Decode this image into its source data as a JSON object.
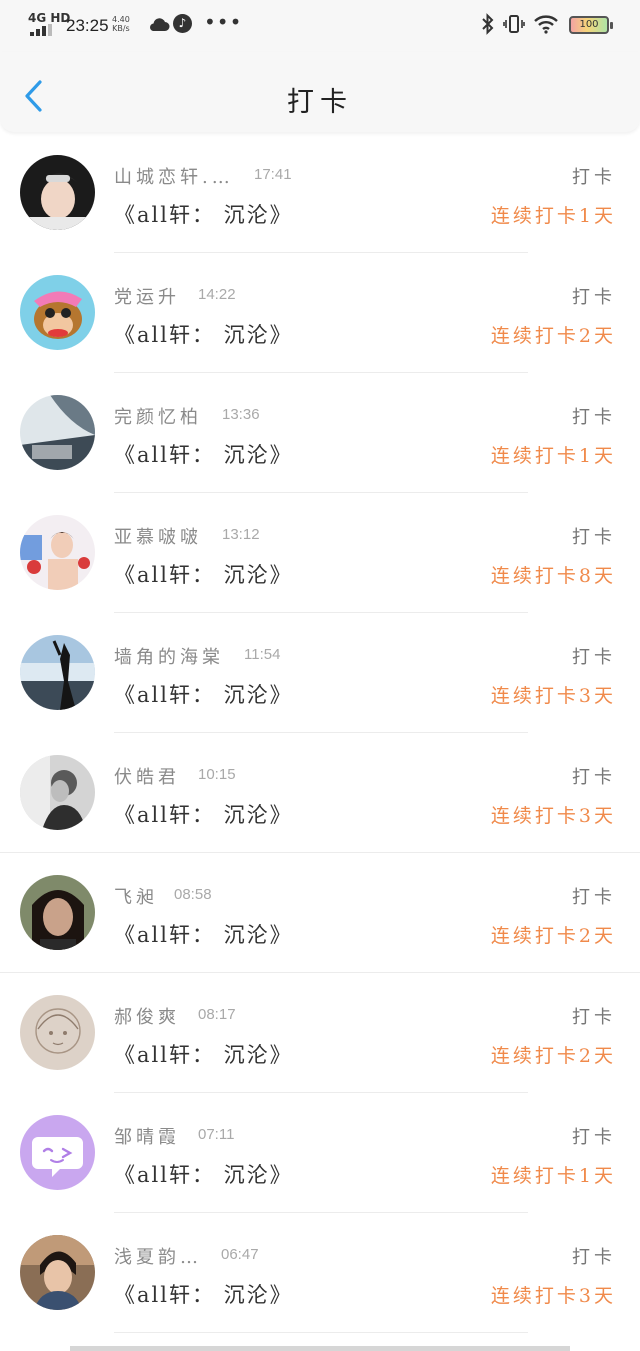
{
  "status_bar": {
    "network": "4G HD",
    "time": "23:25",
    "speed_value": "4.40",
    "speed_unit": "KB/s",
    "battery": "100",
    "icons": [
      "signal-icon",
      "cloud-icon",
      "music-icon",
      "more-dots-icon",
      "bluetooth-icon",
      "vibrate-icon",
      "wifi-icon",
      "battery-icon"
    ]
  },
  "header": {
    "title": "打卡",
    "back_icon": "chevron-left-icon",
    "accent_color": "#2f9be8"
  },
  "entries": [
    {
      "name": "山城恋轩.…",
      "time": "17:41",
      "book": "《all轩： 沉沦》",
      "action": "打卡",
      "streak": "连续打卡1天"
    },
    {
      "name": "党运升",
      "time": "14:22",
      "book": "《all轩： 沉沦》",
      "action": "打卡",
      "streak": "连续打卡2天"
    },
    {
      "name": "完颜忆柏",
      "time": "13:36",
      "book": "《all轩： 沉沦》",
      "action": "打卡",
      "streak": "连续打卡1天"
    },
    {
      "name": "亚慕啵啵",
      "time": "13:12",
      "book": "《all轩： 沉沦》",
      "action": "打卡",
      "streak": "连续打卡8天"
    },
    {
      "name": "墙角的海棠",
      "time": "11:54",
      "book": "《all轩： 沉沦》",
      "action": "打卡",
      "streak": "连续打卡3天"
    },
    {
      "name": "伏皓君",
      "time": "10:15",
      "book": "《all轩： 沉沦》",
      "action": "打卡",
      "streak": "连续打卡3天"
    },
    {
      "name": "飞昶",
      "time": "08:58",
      "book": "《all轩： 沉沦》",
      "action": "打卡",
      "streak": "连续打卡2天"
    },
    {
      "name": "郝俊爽",
      "time": "08:17",
      "book": "《all轩： 沉沦》",
      "action": "打卡",
      "streak": "连续打卡2天"
    },
    {
      "name": "邹晴霞",
      "time": "07:11",
      "book": "《all轩： 沉沦》",
      "action": "打卡",
      "streak": "连续打卡1天"
    },
    {
      "name": "浅夏韵…",
      "time": "06:47",
      "book": "《all轩： 沉沦》",
      "action": "打卡",
      "streak": "连续打卡3天"
    }
  ],
  "colors": {
    "streak": "#f08a4b",
    "name": "#8a8a8a",
    "time": "#a9a9a9",
    "book": "#333333"
  }
}
